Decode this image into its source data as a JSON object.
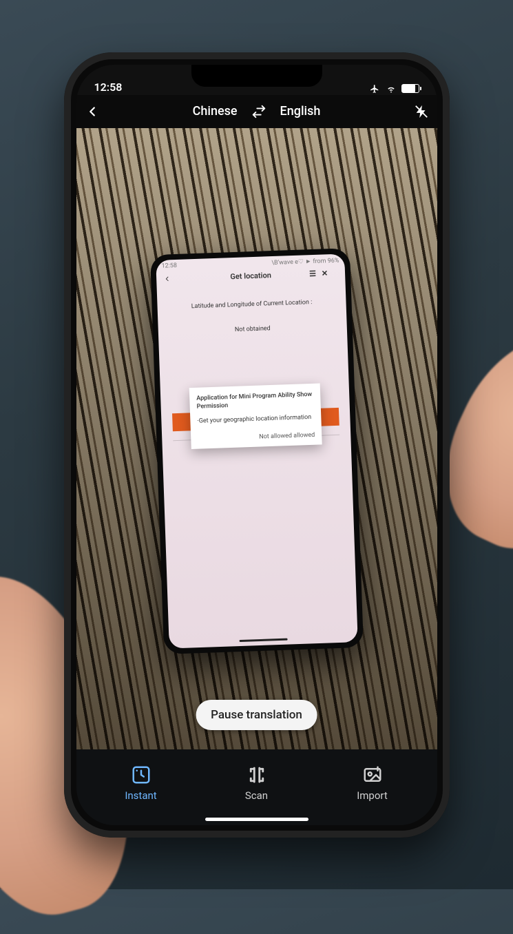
{
  "status_bar": {
    "time": "12:58",
    "airplane": true,
    "wifi": true,
    "battery_pct": 80
  },
  "translate_header": {
    "source_lang": "Chinese",
    "target_lang": "English"
  },
  "pause_button": {
    "label": "Pause translation"
  },
  "bottom_bar": {
    "instant": {
      "label": "Instant",
      "active": true
    },
    "scan": {
      "label": "Scan",
      "active": false
    },
    "import": {
      "label": "Import",
      "active": false
    }
  },
  "inner_phone": {
    "status": {
      "time": "12:58",
      "right_text": "\\B'wave  e♡ ► from 96%"
    },
    "header_title": "Get location",
    "body_line1": "Latitude and Longitude of Current Location :",
    "body_line2": "Not obtained",
    "dialog": {
      "title": "Application for Mini Program Ability Show Permission",
      "desc": "·Get your geographic location information",
      "deny": "Not allowed",
      "allow": "allowed"
    }
  }
}
